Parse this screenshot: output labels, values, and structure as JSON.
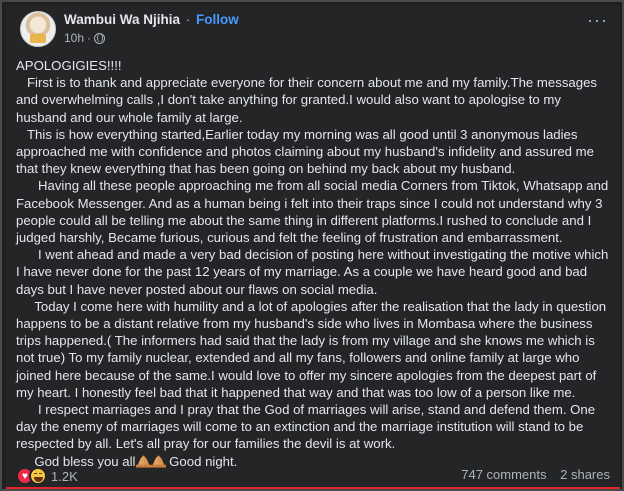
{
  "post": {
    "author": "Wambui Wa Njihia",
    "separator": "·",
    "follow_label": "Follow",
    "time": "10h",
    "meta_separator": "·",
    "paragraphs": [
      "APOLOGIGIES!!!!",
      "   First is to thank and appreciate everyone for their concern about me and my family.The messages and overwhelming calls ,I don't take anything for granted.I would also want to apologise to my husband and our whole family at large.",
      "   This is how everything started,Earlier today my morning was all good until 3 anonymous ladies approached me with confidence and photos claiming about my husband's infidelity and assured me that they knew everything that has been going on behind my back about my husband.",
      "      Having all these people approaching me from all social media Corners from Tiktok, Whatsapp and Facebook Messenger. And as a human being i felt into their traps since I could not understand why 3 people could all be telling me about the same thing in different platforms.I rushed to conclude and I judged harshly, Became furious, curious and felt the feeling of frustration and embarrassment.",
      "      I went ahead and made a very bad decision of posting here without investigating the motive which I have never done for the past 12 years of my marriage. As a couple we have heard good and bad days but I have never posted about our flaws on social media.",
      "     Today I come here with humility and a lot of apologies after the realisation that the lady in question happens to be a distant relative from my husband's side who lives in Mombasa where the business trips happened.( The informers had said that the lady is from my village and she knows me which is not true) To my family nuclear, extended and all my fans, followers and online family at large who joined here because of the same.I would love to offer my sincere apologies from the deepest part of my heart. I honestly feel bad that it happened that way and that was too low of a person like me.",
      "      I respect marriages and I pray that the God of marriages will arise, stand and defend them. One day the enemy of marriages will come to an extinction and the marriage institution will stand to be respected by all. Let's all pray for our families the devil is at work."
    ],
    "closing_text": "     God bless you all",
    "closing_end": " Good night.",
    "closing_emoji": "folded-hands-icon",
    "reaction_count": "1.2K",
    "comments": "747 comments",
    "shares": "2 shares",
    "reactions": [
      "love-reaction-icon",
      "haha-reaction-icon"
    ],
    "colors": {
      "background": "#242526",
      "text": "#e4e6eb",
      "secondary": "#b0b3b8",
      "follow": "#4599ff",
      "love": "#f0284a",
      "haha": "#f7c744",
      "bottom_border": "#e0252b"
    }
  }
}
